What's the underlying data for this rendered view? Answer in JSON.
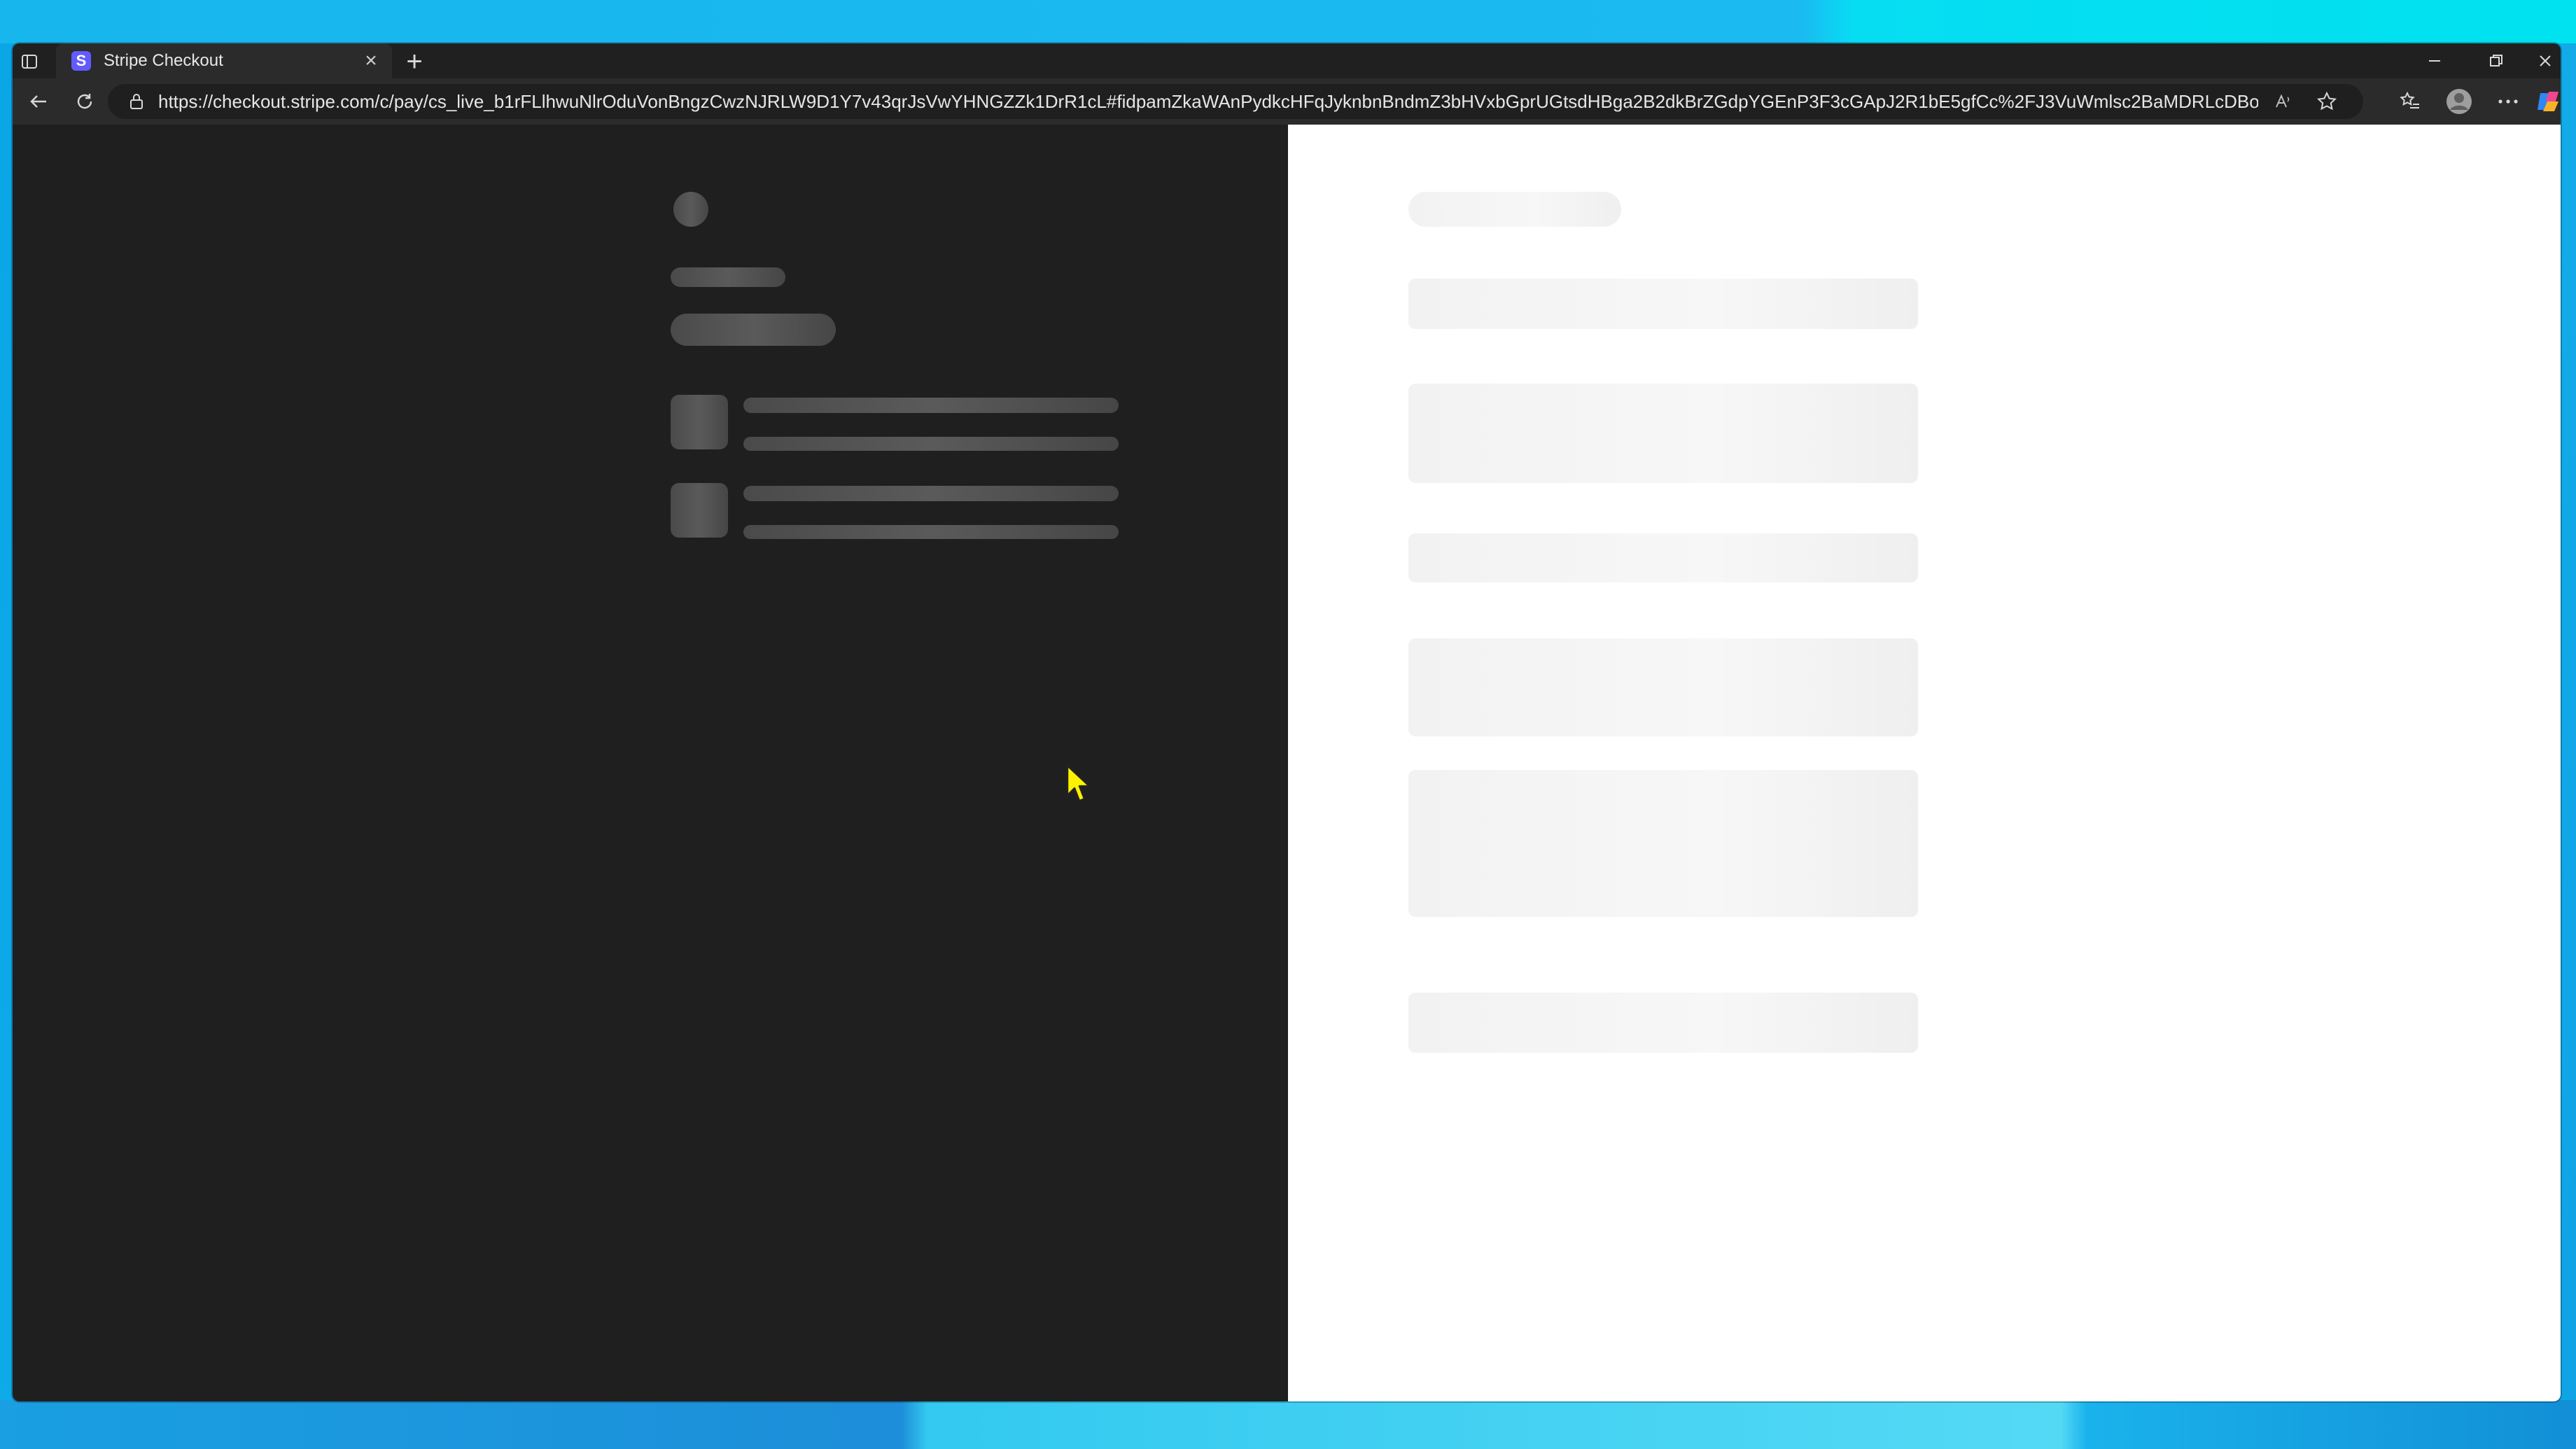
{
  "browser": {
    "tab": {
      "title": "Stripe Checkout",
      "favicon_letter": "S"
    },
    "address_bar": {
      "url": "https://checkout.stripe.com/c/pay/cs_live_b1rFLlhwuNlrOduVonBngzCwzNJRLW9D1Y7v43qrJsVwYHNGZZk1DrR1cL#fidpamZkaWAnPydkcHFqJyknbnBndmZ3bHVxbGprUGtsdHBga2B2dkBrZGdpYGEnP3F3cGApJ2R1bE5gfCc%2FJ3VuWmlsc2BaMDRLcDBoUE..."
    }
  },
  "page": {
    "state": "loading-skeleton"
  },
  "colors": {
    "favicon": "#635bff",
    "left_pane": "#1f1f1f",
    "right_pane": "#ffffff",
    "skeleton_dark": "#505050",
    "skeleton_light": "#f3f3f3",
    "cursor": "#fff200"
  },
  "icons": [
    "tab-actions-icon",
    "close-icon",
    "new-tab-icon",
    "minimize-icon",
    "restore-icon",
    "window-close-icon",
    "back-icon",
    "refresh-icon",
    "lock-icon",
    "read-aloud-icon",
    "favorite-star-icon",
    "favorites-icon",
    "profile-icon",
    "more-icon",
    "copilot-icon",
    "cursor-icon"
  ]
}
